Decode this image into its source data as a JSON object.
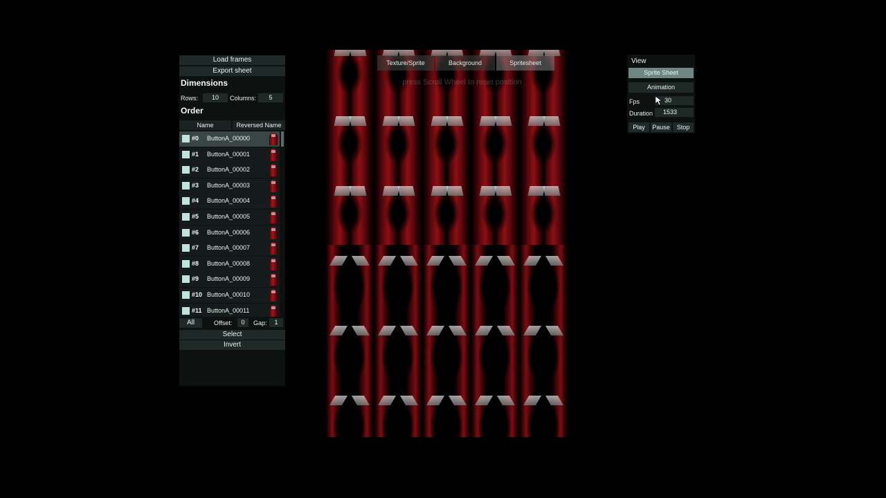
{
  "left_panel": {
    "load_frames": "Load frames",
    "export_sheet": "Export sheet",
    "dimensions_title": "Dimensions",
    "rows_label": "Rows:",
    "rows_value": "10",
    "columns_label": "Columns:",
    "columns_value": "5",
    "order_title": "Order",
    "col_name": "Name",
    "col_reversed": "Reversed Name",
    "frames": [
      {
        "idx": "#0",
        "name": "ButtonA_00000",
        "selected": true
      },
      {
        "idx": "#1",
        "name": "ButtonA_00001"
      },
      {
        "idx": "#2",
        "name": "ButtonA_00002"
      },
      {
        "idx": "#3",
        "name": "ButtonA_00003"
      },
      {
        "idx": "#4",
        "name": "ButtonA_00004"
      },
      {
        "idx": "#5",
        "name": "ButtonA_00005"
      },
      {
        "idx": "#6",
        "name": "ButtonA_00006"
      },
      {
        "idx": "#7",
        "name": "ButtonA_00007"
      },
      {
        "idx": "#8",
        "name": "ButtonA_00008"
      },
      {
        "idx": "#9",
        "name": "ButtonA_00009"
      },
      {
        "idx": "#10",
        "name": "ButtonA_00010"
      },
      {
        "idx": "#11",
        "name": "ButtonA_00011"
      }
    ],
    "all_label": "All",
    "offset_label": "Offset:",
    "offset_value": "0",
    "gap_label": "Gap:",
    "gap_value": "1",
    "select_label": "Select",
    "invert_label": "Invert"
  },
  "center": {
    "tabs": [
      "Texture/Sprite",
      "Background",
      "Spritesheet"
    ],
    "active_tab": "Spritesheet",
    "hint": "press Scroll Wheel to reset position",
    "sheet_columns": 5,
    "sheet_rows_visible": 6
  },
  "right_panel": {
    "view_title": "View",
    "sprite_sheet_label": "Sprite Sheet",
    "animation_label": "Animation",
    "fps_label": "Fps",
    "fps_value": "30",
    "duration_label": "Duration",
    "duration_value": "1533",
    "play_label": "Play",
    "pause_label": "Pause",
    "stop_label": "Stop"
  },
  "colors": {
    "panel_bg": "#0d1110",
    "button_bg": "#1f2a28",
    "active_button": "#6f8783",
    "checkbox": "#bfe3dd",
    "curtain_red": "#b01419"
  }
}
